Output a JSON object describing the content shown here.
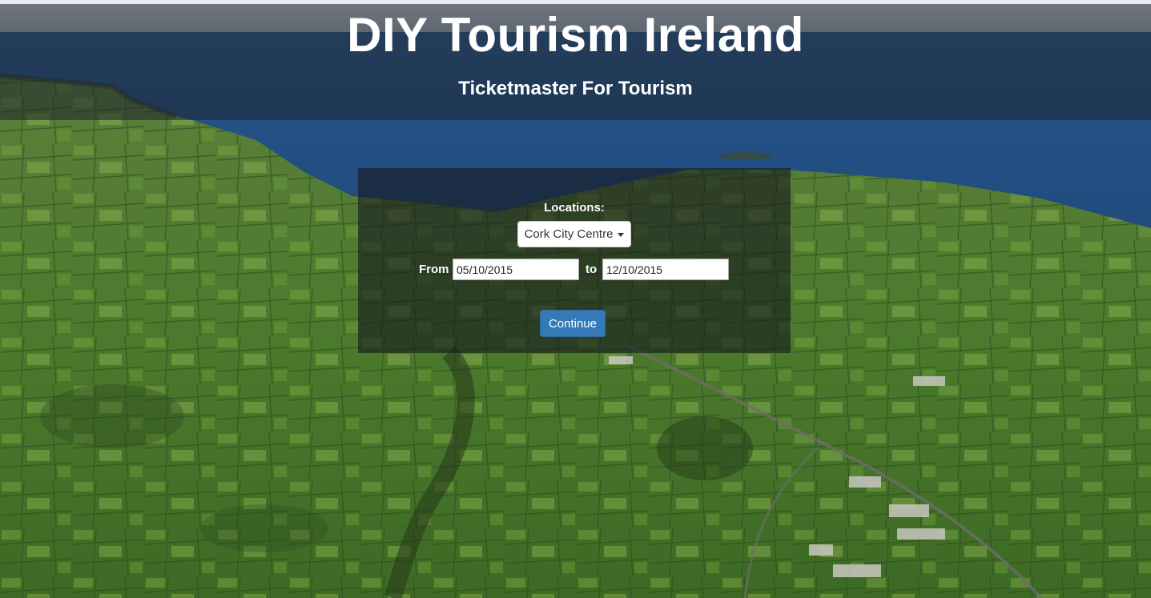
{
  "header": {
    "title": "DIY Tourism Ireland",
    "subtitle": "Ticketmaster For Tourism"
  },
  "form": {
    "locations_label": "Locations:",
    "location_selected": "Cork City Centre",
    "from_label": "From",
    "from_value": "05/10/2015",
    "to_label": "to",
    "to_value": "12/10/2015",
    "continue_label": "Continue"
  },
  "colors": {
    "primary_button": "#337ab7",
    "text_light": "#ffffff"
  },
  "icons": {
    "dropdown_caret": "caret-down-icon"
  }
}
